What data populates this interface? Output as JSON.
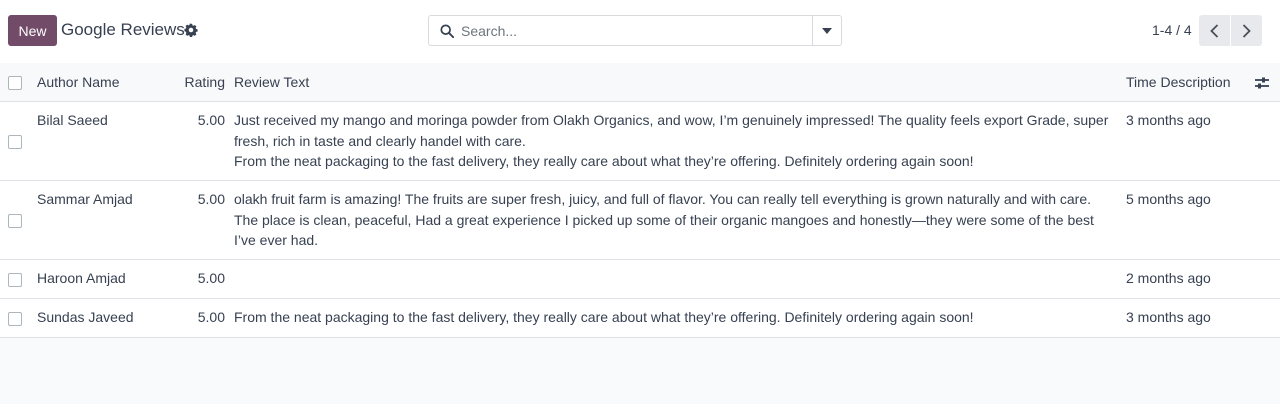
{
  "toolbar": {
    "new_label": "New",
    "title": "Google Reviews",
    "search_placeholder": "Search...",
    "pager_value": "1-4 / 4"
  },
  "columns": {
    "author": "Author Name",
    "rating": "Rating",
    "review": "Review Text",
    "time": "Time Description"
  },
  "rows": [
    {
      "author": "Bilal Saeed",
      "rating": "5.00",
      "review_lines": [
        "Just received my mango and moringa powder from Olakh Organics, and wow, I’m genuinely impressed! The quality feels export Grade, super fresh, rich in taste and clearly handel with care.",
        "From the neat packaging to the fast delivery, they really care about what they’re offering. Definitely ordering again soon!"
      ],
      "time": "3 months ago"
    },
    {
      "author": "Sammar Amjad",
      "rating": "5.00",
      "review_lines": [
        "olakh fruit farm is amazing! The fruits are super fresh, juicy, and full of flavor. You can really tell everything is grown naturally and with care. The place is clean, peaceful, Had a great experience I picked up some of their organic mangoes and honestly—they were some of the best I’ve ever had."
      ],
      "time": "5 months ago"
    },
    {
      "author": "Haroon Amjad",
      "rating": "5.00",
      "review_lines": [],
      "time": "2 months ago"
    },
    {
      "author": "Sundas Javeed",
      "rating": "5.00",
      "review_lines": [
        "From the neat packaging to the fast delivery, they really care about what they’re offering. Definitely ordering again soon!"
      ],
      "time": "3 months ago"
    }
  ],
  "colors": {
    "primary": "#714b67",
    "border": "#dee2e6",
    "text": "#374151"
  },
  "icons": {
    "gear": "gear-icon",
    "search": "search-icon",
    "dropdown": "caret-down-icon",
    "prev": "chevron-left-icon",
    "next": "chevron-right-icon",
    "optional_columns": "sliders-icon"
  }
}
